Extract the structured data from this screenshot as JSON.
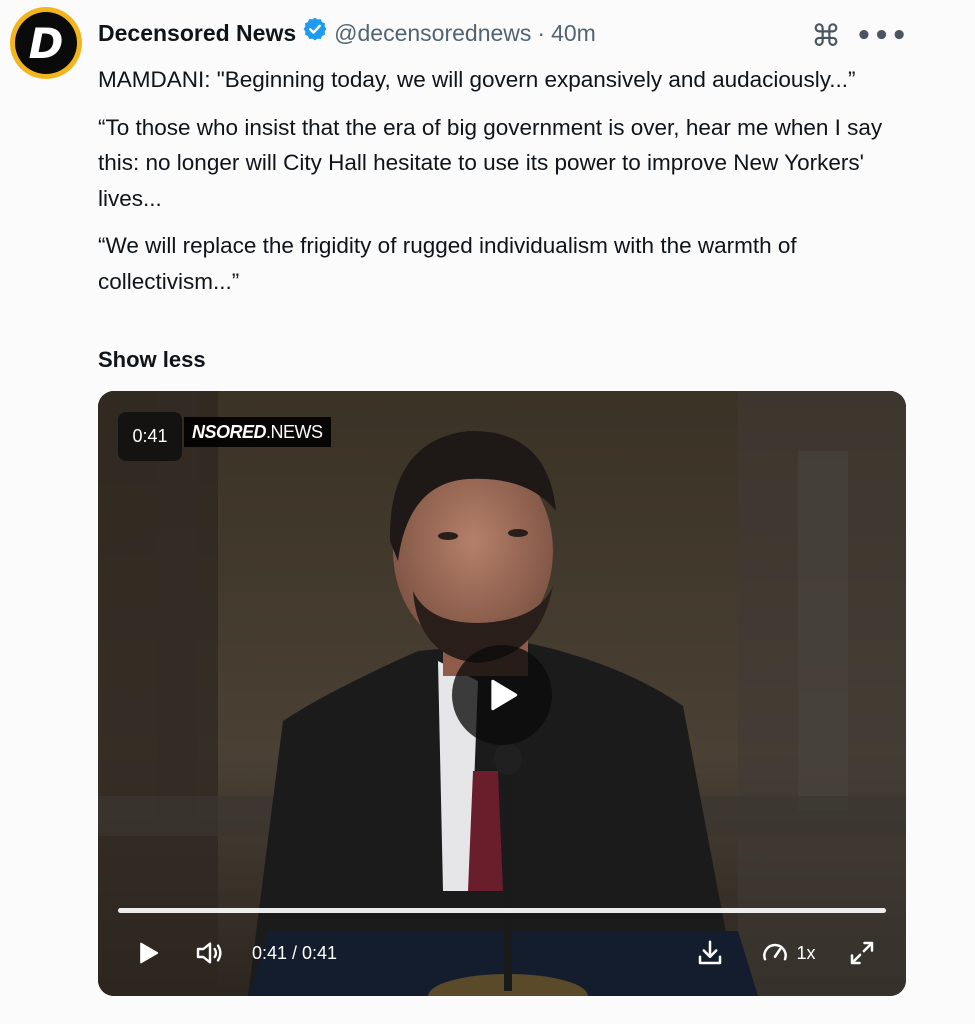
{
  "author": {
    "avatar_letter": "D",
    "name": "Decensored News",
    "handle": "@decensorednews",
    "separator": "·",
    "time": "40m"
  },
  "icons": {
    "verified": "verified-badge-icon",
    "command": "command-icon",
    "more": "more-icon"
  },
  "tweet": {
    "paragraphs": [
      "MAMDANI: \"Beginning today, we will govern expansively and audaciously...”",
      "“To those who insist that the era of big government is over, hear me when I say this: no longer will City Hall hesitate to use its power to improve New Yorkers' lives...",
      "“We will replace the frigidity of rugged individualism with the warmth of collectivism...”"
    ],
    "show_less": "Show less"
  },
  "video": {
    "duration_badge": "0:41",
    "watermark_bold": "NSORED",
    "watermark_light": ".NEWS",
    "progress": 1.0,
    "time_display": "0:41 / 0:41",
    "speed": "1x"
  },
  "colors": {
    "verified_blue": "#1d9bf0",
    "avatar_ring": "#f2b51c"
  }
}
